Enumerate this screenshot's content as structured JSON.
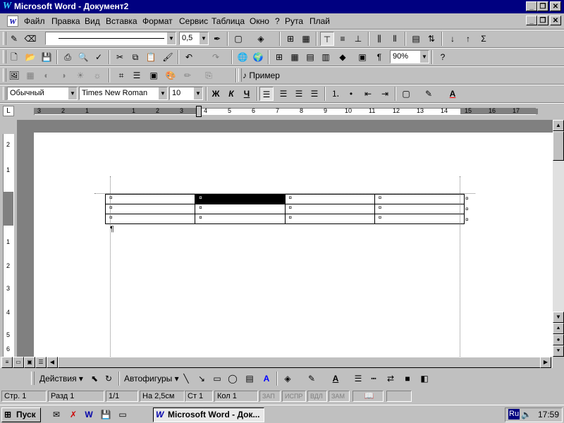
{
  "window": {
    "title": "Microsoft Word - Документ2",
    "app_icon": "W",
    "controls": [
      "_",
      "❐",
      "✕"
    ]
  },
  "menubar": {
    "items": [
      "Файл",
      "Правка",
      "Вид",
      "Вставка",
      "Формат",
      "Сервис",
      "Таблица",
      "Окно",
      "?",
      "Рута",
      "Плай"
    ],
    "doc_controls": [
      "_",
      "❐",
      "✕"
    ]
  },
  "tables_toolbar": {
    "line_weight": "0,5"
  },
  "standard_toolbar": {
    "zoom": "90%"
  },
  "picture_toolbar": {
    "example_label": "Пример"
  },
  "formatting_toolbar": {
    "style": "Обычный",
    "font": "Times New Roman",
    "size": "10",
    "bold": "Ж",
    "italic": "К",
    "underline": "Ч"
  },
  "ruler": {
    "tab_selector": "L",
    "numbers": [
      "3",
      "2",
      "1",
      "1",
      "2",
      "3",
      "4",
      "5",
      "6",
      "7",
      "8",
      "9",
      "10",
      "11",
      "12",
      "13",
      "14",
      "15",
      "16",
      "17"
    ]
  },
  "vruler": {
    "numbers": [
      "2",
      "1",
      "1",
      "2",
      "3",
      "4",
      "5",
      "6"
    ]
  },
  "document": {
    "table": {
      "rows": [
        [
          "¤",
          "¤",
          "¤",
          "¤",
          "¤"
        ],
        [
          "¤",
          "¤",
          "¤",
          "¤",
          "¤"
        ],
        [
          "¤",
          "¤",
          "¤",
          "¤",
          "¤"
        ]
      ],
      "selected_cell": [
        0,
        1
      ]
    },
    "paragraph_mark": "¶"
  },
  "drawing_toolbar": {
    "actions": "Действия",
    "autoshapes": "Автофигуры"
  },
  "statusbar": {
    "page": "Стр. 1",
    "section": "Разд 1",
    "pages": "1/1",
    "at": "На 2,5см",
    "line": "Ст 1",
    "col": "Кол 1",
    "rec": "ЗАП",
    "trk": "ИСПР",
    "ext": "ВДЛ",
    "ovr": "ЗАМ"
  },
  "taskbar": {
    "start": "Пуск",
    "task": "Microsoft Word - Док...",
    "lang": "Ru",
    "time": "17:59"
  },
  "colors": {
    "titlebar": "#000080",
    "face": "#c0c0c0",
    "selection": "#000000"
  }
}
